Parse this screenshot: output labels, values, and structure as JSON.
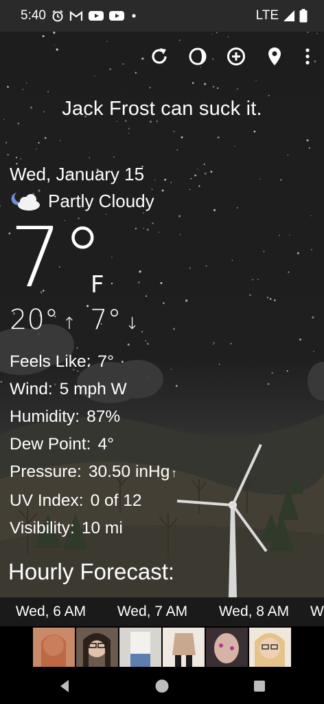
{
  "status_bar": {
    "time": "5:40",
    "network": "LTE",
    "icons": [
      "alarm-icon",
      "gmail-icon",
      "youtube-icon",
      "youtube-icon",
      "dot-icon",
      "signal-icon",
      "battery-icon"
    ]
  },
  "toolbar": {
    "icons": [
      "refresh-icon",
      "theme-icon",
      "add-icon",
      "location-icon",
      "more-icon"
    ]
  },
  "header": {
    "tagline": "Jack Frost can suck it."
  },
  "weather": {
    "date": "Wed, January 15",
    "condition": "Partly Cloudy",
    "condition_icon": "partly-cloudy-night-icon",
    "temperature": "7°",
    "unit": "F",
    "high": "20°",
    "high_arrow": "↑",
    "low": "7°",
    "low_arrow": "↓"
  },
  "details": {
    "feels_like_label": "Feels Like:",
    "feels_like_value": "7°",
    "wind_label": "Wind:",
    "wind_value": "5 mph W",
    "humidity_label": "Humidity:",
    "humidity_value": "87%",
    "dew_point_label": "Dew Point:",
    "dew_point_value": "4°",
    "pressure_label": "Pressure:",
    "pressure_value": "30.50 inHg",
    "pressure_trend": "↑",
    "uv_label": "UV Index:",
    "uv_value": "0 of 12",
    "visibility_label": "Visibility:",
    "visibility_value": "10 mi"
  },
  "hourly": {
    "title": "Hourly Forecast:",
    "items": [
      "Wed, 6 AM",
      "Wed, 7 AM",
      "Wed, 8 AM",
      "W"
    ]
  },
  "ad": {
    "images": [
      "ad-photo-1",
      "ad-photo-2",
      "ad-photo-3",
      "ad-photo-4",
      "ad-photo-5",
      "ad-photo-6"
    ]
  },
  "nav": {
    "icons": [
      "back-icon",
      "home-icon",
      "recents-icon"
    ]
  },
  "colors": {
    "sky": "#1e1e1e",
    "status_bar": "#2a2a2a",
    "text": "#ffffff"
  }
}
